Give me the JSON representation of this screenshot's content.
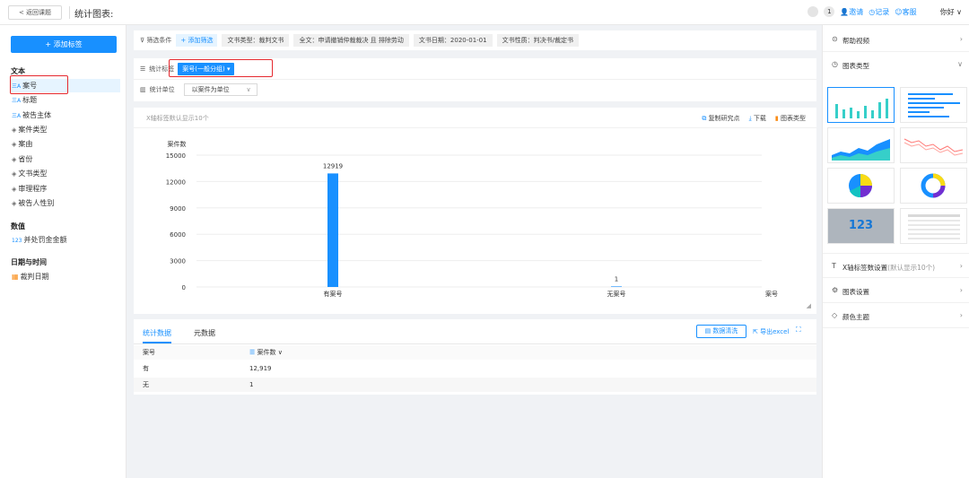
{
  "header": {
    "back_label": "返回课题",
    "title": "统计图表:",
    "badge_count": "1",
    "invite": "邀请",
    "record": "记录",
    "customer_service": "客服",
    "user": "你好 ∨"
  },
  "sidebar": {
    "add_button": "+ 添加标签",
    "groups": [
      {
        "title": "文本",
        "items": [
          "案号",
          "标题",
          "被告主体",
          "案件类型",
          "案由",
          "省份",
          "文书类型",
          "审理程序",
          "被告人性别"
        ]
      },
      {
        "title": "数值",
        "items": [
          "并处罚金金额"
        ]
      },
      {
        "title": "日期与时间",
        "items": [
          "裁判日期"
        ]
      }
    ],
    "selected": "案号",
    "icon_text": "三A",
    "icon_num": "123"
  },
  "filters": {
    "label": "筛选条件",
    "add": "+ 添加筛选",
    "chips": [
      "文书类型：裁判文书",
      "全文：申请撤销仲裁裁决 且 排除劳动",
      "文书日期：2020-01-01",
      "文书性质：判决书/裁定书"
    ]
  },
  "tag_panel": {
    "stat_tag_label": "统计标签",
    "stat_tag_value": "案号(一般分组) ▾",
    "stat_unit_label": "统计单位",
    "stat_unit_value": "以案件为单位"
  },
  "chart_toolbar": {
    "hint": "X轴标签默认显示10个",
    "copy": "复制研究点",
    "download": "下载",
    "chart_type": "图表类型"
  },
  "chart_data": {
    "type": "bar",
    "ylabel": "案件数",
    "xlabel": "案号",
    "categories": [
      "有案号",
      "无案号"
    ],
    "values": [
      12919,
      1
    ],
    "ylim": [
      0,
      15000
    ],
    "yticks": [
      0,
      3000,
      6000,
      9000,
      12000,
      15000
    ],
    "grid": true,
    "bar_color": "#1890ff"
  },
  "table": {
    "tabs": [
      "统计数据",
      "元数据"
    ],
    "clean_button": "数据清洗",
    "export_button": "导出excel",
    "columns": [
      "案号",
      "案件数"
    ],
    "rows": [
      [
        "有",
        "12,919"
      ],
      [
        "无",
        "1"
      ]
    ]
  },
  "right_panel": {
    "help_video": "帮助视频",
    "chart_type": "图表类型",
    "thumb_number": "123",
    "x_label_setting": "X轴标签数设置",
    "x_label_setting_sub": "(默认显示10个)",
    "chart_setting": "图表设置",
    "color_theme": "颜色主题"
  }
}
